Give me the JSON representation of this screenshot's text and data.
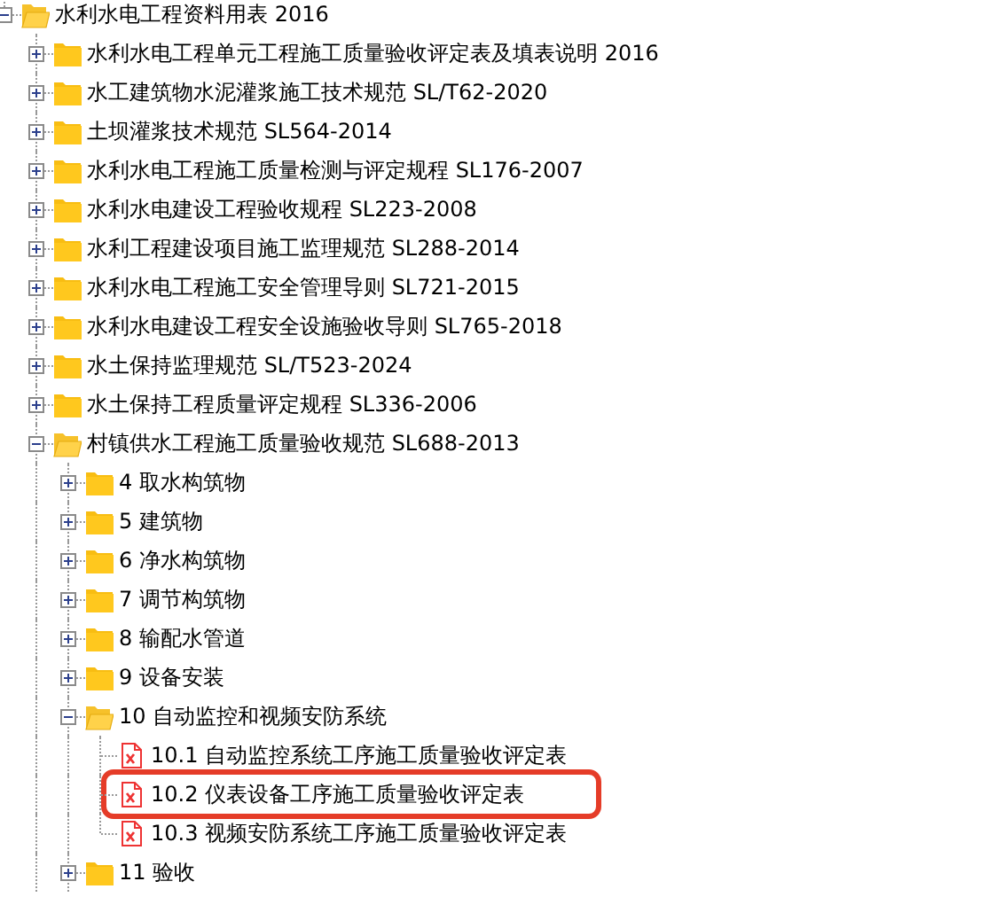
{
  "tree": [
    {
      "label": "水利水电工程资料用表 2016",
      "kind": "folder",
      "expanded": true,
      "children": [
        {
          "label": "水利水电工程单元工程施工质量验收评定表及填表说明 2016",
          "kind": "folder",
          "expanded": false
        },
        {
          "label": "水工建筑物水泥灌浆施工技术规范 SL/T62-2020",
          "kind": "folder",
          "expanded": false
        },
        {
          "label": "土坝灌浆技术规范 SL564-2014",
          "kind": "folder",
          "expanded": false
        },
        {
          "label": "水利水电工程施工质量检测与评定规程 SL176-2007",
          "kind": "folder",
          "expanded": false
        },
        {
          "label": "水利水电建设工程验收规程 SL223-2008",
          "kind": "folder",
          "expanded": false
        },
        {
          "label": "水利工程建设项目施工监理规范 SL288-2014",
          "kind": "folder",
          "expanded": false
        },
        {
          "label": "水利水电工程施工安全管理导则 SL721-2015",
          "kind": "folder",
          "expanded": false
        },
        {
          "label": "水利水电建设工程安全设施验收导则 SL765-2018",
          "kind": "folder",
          "expanded": false
        },
        {
          "label": "水土保持监理规范 SL/T523-2024",
          "kind": "folder",
          "expanded": false
        },
        {
          "label": "水土保持工程质量评定规程 SL336-2006",
          "kind": "folder",
          "expanded": false
        },
        {
          "label": "村镇供水工程施工质量验收规范 SL688-2013",
          "kind": "folder",
          "expanded": true,
          "continues_below": true,
          "children": [
            {
              "label": "4 取水构筑物",
              "kind": "folder",
              "expanded": false
            },
            {
              "label": "5 建筑物",
              "kind": "folder",
              "expanded": false
            },
            {
              "label": "6 净水构筑物",
              "kind": "folder",
              "expanded": false
            },
            {
              "label": "7 调节构筑物",
              "kind": "folder",
              "expanded": false
            },
            {
              "label": "8 输配水管道",
              "kind": "folder",
              "expanded": false
            },
            {
              "label": "9 设备安装",
              "kind": "folder",
              "expanded": false
            },
            {
              "label": "10 自动监控和视频安防系统",
              "kind": "folder",
              "expanded": true,
              "children": [
                {
                  "label": "10.1 自动监控系统工序施工质量验收评定表",
                  "kind": "file",
                  "highlighted": false
                },
                {
                  "label": "10.2 仪表设备工序施工质量验收评定表",
                  "kind": "file",
                  "highlighted": true
                },
                {
                  "label": "10.3 视频安防系统工序施工质量验收评定表",
                  "kind": "file",
                  "highlighted": false
                }
              ]
            },
            {
              "label": "11 验收",
              "kind": "folder",
              "expanded": false,
              "continues_below": true
            }
          ]
        }
      ]
    }
  ]
}
